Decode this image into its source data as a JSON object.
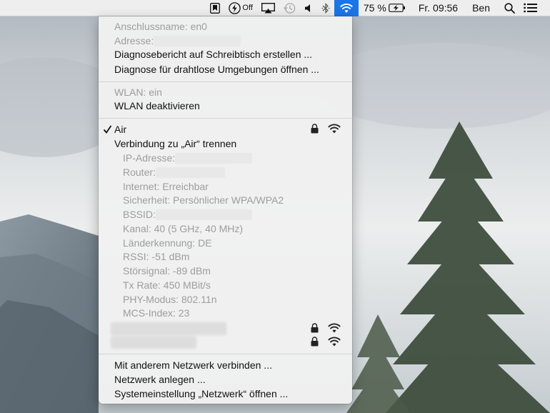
{
  "menubar": {
    "battery_cut_label": "Off",
    "battery_percent": "75 %",
    "clock": "Fr. 09:56",
    "user": "Ben"
  },
  "menu": {
    "interface_name": "Anschlussname: en0",
    "address_label": "Adresse:",
    "diagnose_report": "Diagnosebericht auf Schreibtisch erstellen ...",
    "diagnose_wireless": "Diagnose für drahtlose Umgebungen öffnen ...",
    "wlan_status": "WLAN: ein",
    "wlan_toggle": "WLAN deaktivieren",
    "connected_network": "Air",
    "disconnect": "Verbindung zu „Air“ trennen",
    "details": {
      "ip_label": "IP-Adresse:",
      "router_label": "Router:",
      "internet": "Internet: Erreichbar",
      "security": "Sicherheit: Persönlicher WPA/WPA2",
      "bssid_label": "BSSID:",
      "channel": "Kanal: 40 (5 GHz, 40 MHz)",
      "country": "Länderkennung: DE",
      "rssi": "RSSI: -51 dBm",
      "noise": "Störsignal: -89 dBm",
      "tx_rate": "Tx Rate: 450 MBit/s",
      "phy_mode": "PHY-Modus: 802.11n",
      "mcs_index": "MCS-Index: 23"
    },
    "other_network": "Mit anderem Netzwerk verbinden ...",
    "create_network": "Netzwerk anlegen ...",
    "network_prefs": "Systemeinstellung „Netzwerk“ öffnen ..."
  },
  "colors": {
    "accent": "#1b74e8",
    "disabled_text": "#9d9d9d"
  }
}
